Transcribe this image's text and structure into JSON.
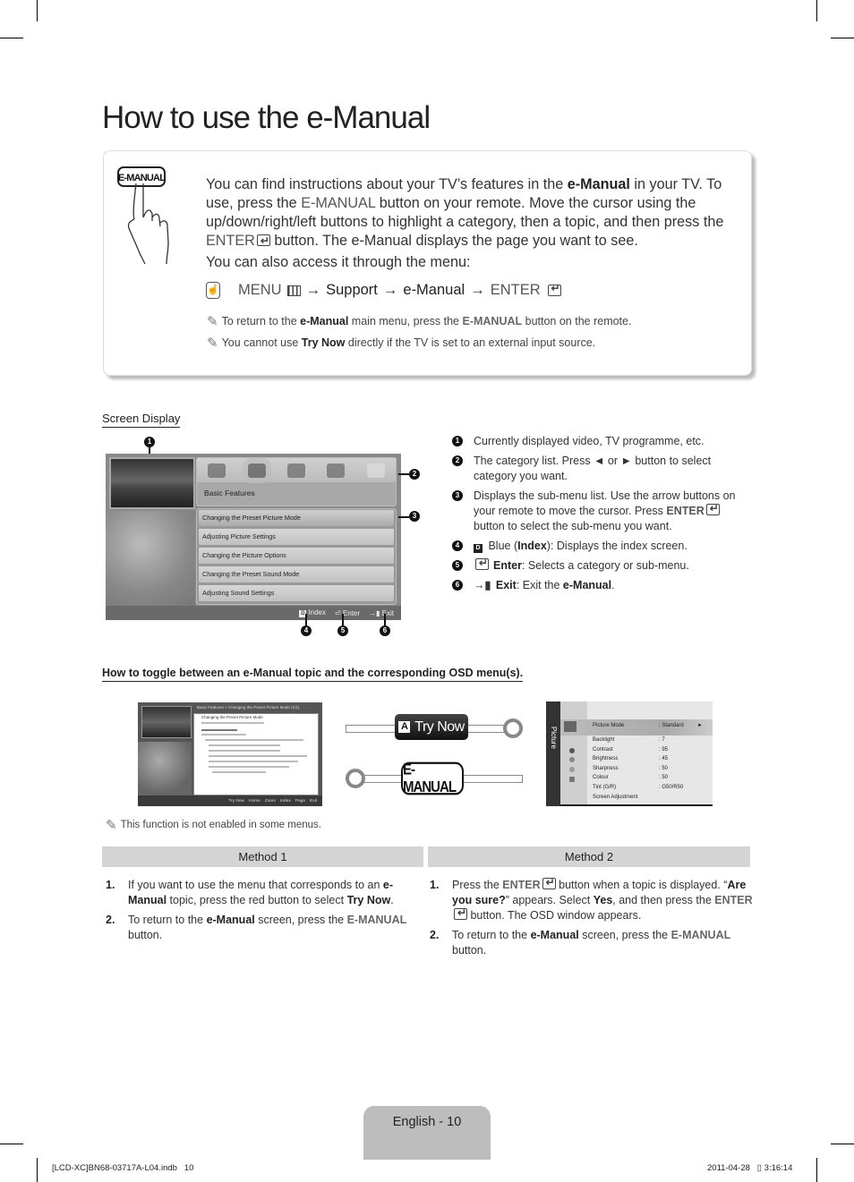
{
  "page_title": "How to use the e-Manual",
  "intro": {
    "button_label": "E-MANUAL",
    "p1_a": "You can find instructions about your TV’s features in the ",
    "p1_b": "e-Manual",
    "p1_c": " in your TV. To use, press the ",
    "p1_d": "E-MANUAL",
    "p1_e": " button on your remote. Move the cursor using the up/down/right/left buttons to highlight a category, then a topic, and then press the ",
    "p1_f": "ENTER",
    "p1_g": " button. The e-Manual displays the page you want to see.",
    "p2": "You can also access it through the menu:",
    "menu_path": {
      "menu": "MENU",
      "arrow": "→",
      "support": "Support",
      "emanual": "e-Manual",
      "enter": "ENTER"
    },
    "notes": [
      {
        "a": "To return to the ",
        "b": "e-Manual",
        "c": " main menu, press the ",
        "d": "E-MANUAL",
        "e": " button on the remote."
      },
      {
        "a": "You cannot use ",
        "b": "Try Now",
        "c": " directly if the TV is set to an external input source."
      }
    ]
  },
  "screen_display": {
    "label": "Screen Display",
    "category_label": "Basic Features",
    "submenu": [
      "Changing the Preset Picture Mode",
      "Adjusting Picture Settings",
      "Changing the Picture Options",
      "Changing the Preset Sound Mode",
      "Adjusting Sound Settings"
    ],
    "bar": {
      "index_key": "D",
      "index": "Index",
      "enter": "Enter",
      "exit": "Exit"
    },
    "callouts": [
      "1",
      "2",
      "3",
      "4",
      "5",
      "6"
    ]
  },
  "legend": {
    "items": [
      {
        "n": "1",
        "text": "Currently displayed video, TV programme, etc."
      },
      {
        "n": "2",
        "text": "The category list. Press ◄ or ► button to select category you want."
      },
      {
        "n": "3",
        "a": "Displays the sub-menu list. Use the arrow buttons on your remote to move the cursor. Press ",
        "b": "ENTER",
        "c": " button to select the sub-menu you want."
      },
      {
        "n": "4",
        "key": "D",
        "a": " Blue (",
        "b": "Index",
        "c": "): Displays the index screen."
      },
      {
        "n": "5",
        "b": "Enter",
        "c": ": Selects a category or sub-menu."
      },
      {
        "n": "6",
        "icon": "→▮",
        "b": "Exit",
        "c": ": Exit the ",
        "d": "e-Manual",
        "e": "."
      }
    ]
  },
  "toggle": {
    "heading": "How to toggle between an e-Manual topic and the corresponding OSD menu(s).",
    "emanual_screen": {
      "header": "Basic Features > Changing the Preset Picture Mode (1/1)",
      "topic": "Changing the Preset Picture Mode",
      "bar": [
        "Try Now",
        "Home",
        "Zoom",
        "Index",
        "Page",
        "Exit"
      ]
    },
    "trynow_key": "A",
    "trynow_label": "Try Now",
    "emanual_button": "E-MANUAL",
    "osd": {
      "side_label": "Picture",
      "rows": [
        {
          "label": "Picture Mode",
          "value": ": Standard",
          "selected": true
        },
        {
          "label": "Backlight",
          "value": ": 7"
        },
        {
          "label": "Contrast",
          "value": ": 95"
        },
        {
          "label": "Brightness",
          "value": ": 45"
        },
        {
          "label": "Sharpness",
          "value": ": 50"
        },
        {
          "label": "Colour",
          "value": ": 50"
        },
        {
          "label": "Tint (G/R)",
          "value": ": G50/R50"
        },
        {
          "label": "Screen Adjustment",
          "value": ""
        }
      ]
    },
    "note": "This function is not enabled in some menus."
  },
  "methods": {
    "m1_title": "Method 1",
    "m2_title": "Method 2",
    "m1": [
      {
        "n": "1.",
        "a": "If you want to use the menu that corresponds to an ",
        "b": "e-Manual",
        "c": " topic, press the red button to select ",
        "d": "Try Now",
        "e": "."
      },
      {
        "n": "2.",
        "a": "To return to the ",
        "b": "e-Manual",
        "c": " screen, press the ",
        "d": "E-MANUAL",
        "e": " button."
      }
    ],
    "m2": [
      {
        "n": "1.",
        "a": "Press the ",
        "b": "ENTER",
        "c": " button when a topic is displayed. “",
        "d": "Are you sure?",
        "e": "” appears. Select ",
        "f": "Yes",
        "g": ", and then press the ",
        "h": "ENTER",
        "i": " button. The OSD window appears."
      },
      {
        "n": "2.",
        "a": "To return to the ",
        "b": "e-Manual",
        "c": " screen, press the ",
        "d": "E-MANUAL",
        "e": " button."
      }
    ]
  },
  "footer": {
    "page_label": "English - 10",
    "file": "[LCD-XC]BN68-03717A-L04.indb   10",
    "timestamp": "2011-04-28   ▯ 3:16:14"
  }
}
